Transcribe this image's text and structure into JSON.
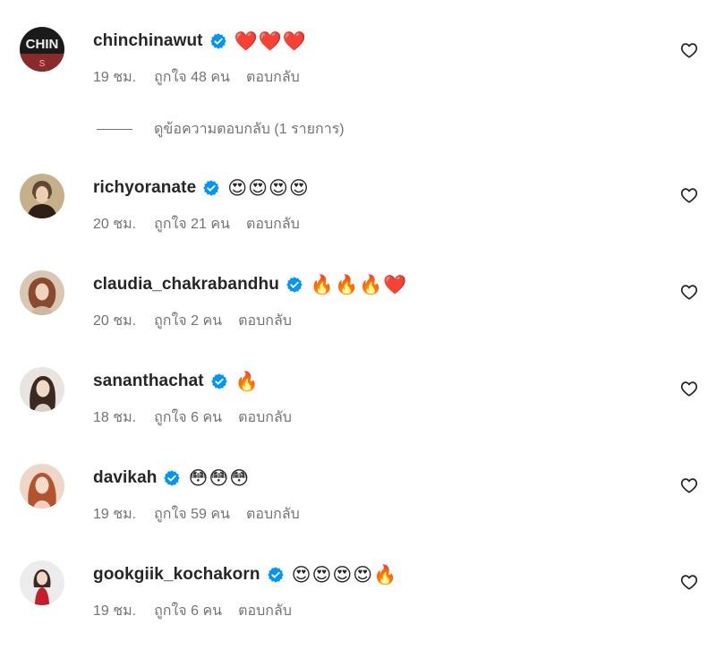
{
  "comments": [
    {
      "username": "chinchinawut",
      "emojis": "❤️❤️❤️",
      "time": "19 ชม.",
      "likes": "ถูกใจ 48 คน",
      "reply": "ตอบกลับ",
      "avatar_text": "CHIN",
      "avatar_colors": [
        "#1a1a1a",
        "#8b2a2a"
      ]
    },
    {
      "username": "richyoranate",
      "emojis": "😍😍😍😍",
      "time": "20 ชม.",
      "likes": "ถูกใจ 21 คน",
      "reply": "ตอบกลับ",
      "avatar_colors": [
        "#c7b089",
        "#2b2118"
      ]
    },
    {
      "username": "claudia_chakrabandhu",
      "emojis": "🔥🔥🔥❤️",
      "time": "20 ชม.",
      "likes": "ถูกใจ 2 คน",
      "reply": "ตอบกลับ",
      "avatar_colors": [
        "#d9c6b3",
        "#8a4a2e"
      ]
    },
    {
      "username": "sananthachat",
      "emojis": "🔥",
      "time": "18 ชม.",
      "likes": "ถูกใจ 6 คน",
      "reply": "ตอบกลับ",
      "avatar_colors": [
        "#e8e4df",
        "#3b2a22"
      ]
    },
    {
      "username": "davikah",
      "emojis": "😳😳😳",
      "time": "19 ชม.",
      "likes": "ถูกใจ 59 คน",
      "reply": "ตอบกลับ",
      "avatar_colors": [
        "#f0d6c8",
        "#b4532f"
      ]
    },
    {
      "username": "gookgiik_kochakorn",
      "emojis": "😍😍😍😍🔥",
      "time": "19 ชม.",
      "likes": "ถูกใจ 6 คน",
      "reply": "ตอบกลับ",
      "avatar_colors": [
        "#ececec",
        "#c41e2a"
      ]
    }
  ],
  "view_replies": "ดูข้อความตอบกลับ (1 รายการ)",
  "colors": {
    "verified": "#0095f6",
    "text": "#262626",
    "secondary": "#737373"
  },
  "icons": {
    "verified": "verified-badge-icon",
    "like": "heart-outline-icon"
  }
}
